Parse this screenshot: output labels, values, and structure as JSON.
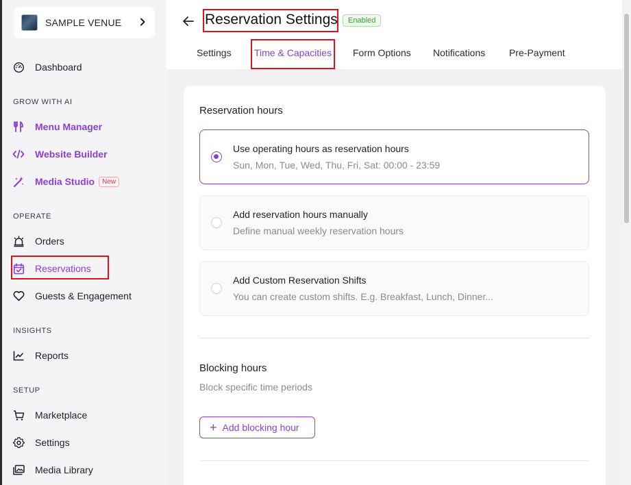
{
  "sidebar": {
    "venue_name": "SAMPLE VENUE",
    "dashboard": "Dashboard",
    "sections": {
      "grow": "GROW WITH AI",
      "operate": "OPERATE",
      "insights": "INSIGHTS",
      "setup": "SETUP"
    },
    "grow_items": [
      "Menu Manager",
      "Website Builder",
      "Media Studio"
    ],
    "new_badge": "New",
    "operate_items": [
      "Orders",
      "Reservations",
      "Guests & Engagement"
    ],
    "insights_items": [
      "Reports"
    ],
    "setup_items": [
      "Marketplace",
      "Settings",
      "Media Library"
    ]
  },
  "header": {
    "title": "Reservation Settings",
    "status": "Enabled",
    "tabs": [
      "Settings",
      "Time & Capacities",
      "Form Options",
      "Notifications",
      "Pre-Payment"
    ],
    "active_tab": "Time & Capacities"
  },
  "reservation_hours": {
    "heading": "Reservation hours",
    "options": [
      {
        "title": "Use operating hours as reservation hours",
        "subtitle": "Sun, Mon, Tue, Wed, Thu, Fri, Sat: 00:00 - 23:59",
        "selected": true
      },
      {
        "title": "Add reservation hours manually",
        "subtitle": "Define manual weekly reservation hours",
        "selected": false
      },
      {
        "title": "Add Custom Reservation Shifts",
        "subtitle": "You can create custom shifts. E.g. Breakfast, Lunch, Dinner...",
        "selected": false
      }
    ]
  },
  "blocking_hours": {
    "heading": "Blocking hours",
    "subtitle": "Block specific time periods",
    "add_button": "Add blocking hour"
  },
  "colors": {
    "accent": "#8a3fd6",
    "annotation_red": "#d9141e",
    "enabled_green": "#3d9a3d"
  }
}
